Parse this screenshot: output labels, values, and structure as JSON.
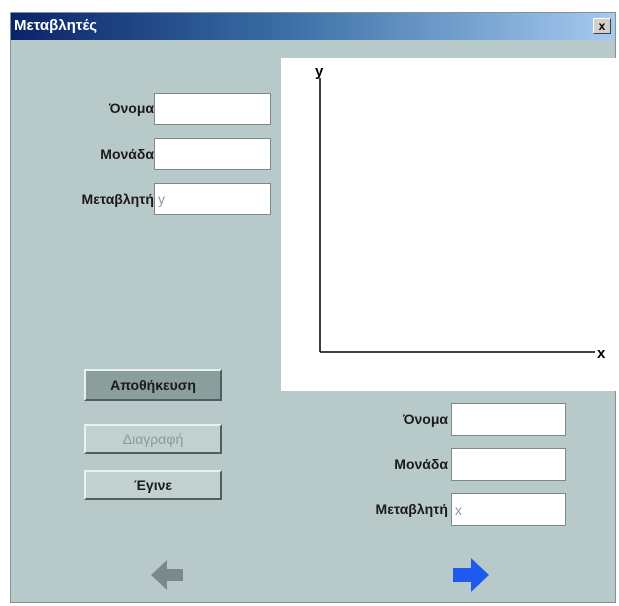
{
  "window": {
    "title": "Μεταβλητές",
    "close_label": "x"
  },
  "y_variable": {
    "name_label": "Όνομα",
    "name_value": "",
    "unit_label": "Μονάδα",
    "unit_value": "",
    "variable_label": "Μεταβλητή",
    "variable_value": "y"
  },
  "x_variable": {
    "name_label": "Όνομα",
    "name_value": "",
    "unit_label": "Μονάδα",
    "unit_value": "",
    "variable_label": "Μεταβλητή",
    "variable_value": "x"
  },
  "plot": {
    "y_axis_label": "y",
    "x_axis_label": "x"
  },
  "buttons": {
    "save": "Αποθήκευση",
    "delete": "Διαγραφή",
    "done": "Έγινε"
  },
  "nav": {
    "back_icon": "arrow-left-icon",
    "forward_icon": "arrow-right-icon",
    "back_color": "#7a8a8a",
    "forward_color": "#1e5af0"
  }
}
